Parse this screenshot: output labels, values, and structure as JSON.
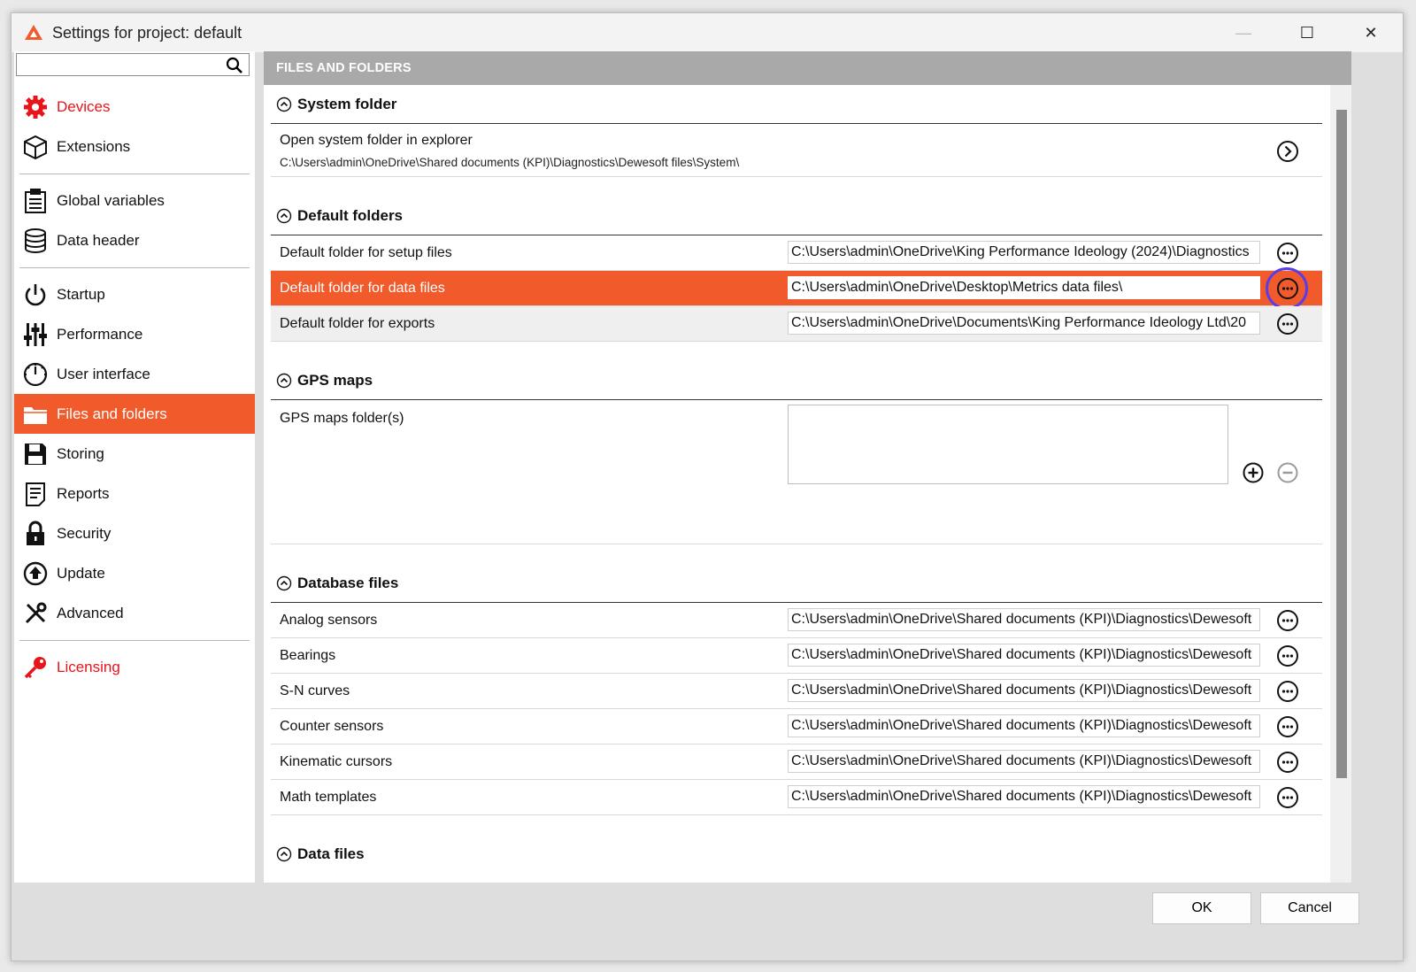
{
  "window": {
    "title": "Settings for project: default",
    "minimize": "—",
    "maximize": "☐",
    "close": "✕"
  },
  "search": {
    "value": "",
    "placeholder": ""
  },
  "sidebar": {
    "items": [
      {
        "label": "Devices",
        "icon": "gear-icon",
        "color": "#e8141b"
      },
      {
        "label": "Extensions",
        "icon": "cube-icon"
      },
      {
        "label": "Global variables",
        "icon": "clipboard-icon"
      },
      {
        "label": "Data header",
        "icon": "database-icon"
      },
      {
        "label": "Startup",
        "icon": "power-icon"
      },
      {
        "label": "Performance",
        "icon": "sliders-icon"
      },
      {
        "label": "User interface",
        "icon": "gauge-icon"
      },
      {
        "label": "Files and folders",
        "icon": "folder-icon",
        "active": true
      },
      {
        "label": "Storing",
        "icon": "floppy-icon"
      },
      {
        "label": "Reports",
        "icon": "report-icon"
      },
      {
        "label": "Security",
        "icon": "lock-icon"
      },
      {
        "label": "Update",
        "icon": "upload-icon"
      },
      {
        "label": "Advanced",
        "icon": "tools-icon"
      },
      {
        "label": "Licensing",
        "icon": "key-icon",
        "color": "#e8141b"
      }
    ]
  },
  "content": {
    "header": "FILES AND FOLDERS",
    "system_folder": {
      "title": "System folder",
      "open_label": "Open system folder in explorer",
      "path": "C:\\Users\\admin\\OneDrive\\Shared documents (KPI)\\Diagnostics\\Dewesoft files\\System\\"
    },
    "default_folders": {
      "title": "Default folders",
      "rows": [
        {
          "label": "Default folder for setup files",
          "path": "C:\\Users\\admin\\OneDrive\\King Performance Ideology (2024)\\Diagnostics"
        },
        {
          "label": "Default folder for data files",
          "path": "C:\\Users\\admin\\OneDrive\\Desktop\\Metrics data files\\"
        },
        {
          "label": "Default folder for exports",
          "path": "C:\\Users\\admin\\OneDrive\\Documents\\King Performance Ideology Ltd\\20"
        }
      ]
    },
    "gps_maps": {
      "title": "GPS maps",
      "label": "GPS maps folder(s)"
    },
    "database_files": {
      "title": "Database files",
      "rows": [
        {
          "label": "Analog sensors",
          "path": "C:\\Users\\admin\\OneDrive\\Shared documents (KPI)\\Diagnostics\\Dewesoft"
        },
        {
          "label": "Bearings",
          "path": "C:\\Users\\admin\\OneDrive\\Shared documents (KPI)\\Diagnostics\\Dewesoft"
        },
        {
          "label": "S-N curves",
          "path": "C:\\Users\\admin\\OneDrive\\Shared documents (KPI)\\Diagnostics\\Dewesoft"
        },
        {
          "label": "Counter sensors",
          "path": "C:\\Users\\admin\\OneDrive\\Shared documents (KPI)\\Diagnostics\\Dewesoft"
        },
        {
          "label": "Kinematic cursors",
          "path": "C:\\Users\\admin\\OneDrive\\Shared documents (KPI)\\Diagnostics\\Dewesoft"
        },
        {
          "label": "Math templates",
          "path": "C:\\Users\\admin\\OneDrive\\Shared documents (KPI)\\Diagnostics\\Dewesoft"
        }
      ]
    },
    "data_files": {
      "title": "Data files"
    }
  },
  "footer": {
    "ok": "OK",
    "cancel": "Cancel"
  },
  "colors": {
    "accent": "#f15a2b",
    "alert": "#e8141b",
    "focus": "#5b3de8"
  }
}
